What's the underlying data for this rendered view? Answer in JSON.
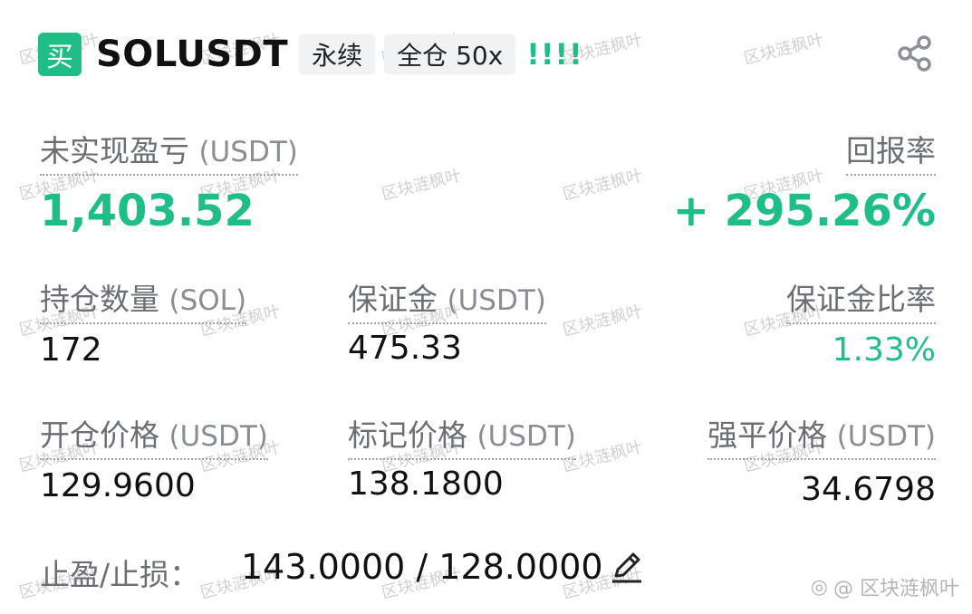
{
  "header": {
    "buy_badge": "买",
    "symbol": "SOLUSDT",
    "tag_perpetual": "永续",
    "tag_margin": "全仓 50x",
    "alert_marks": "!!!!"
  },
  "pnl": {
    "label": "未实现盈亏",
    "unit": "(USDT)",
    "value": "1,403.52"
  },
  "roe": {
    "label": "回报率",
    "value": "+ 295.26%"
  },
  "position_size": {
    "label": "持仓数量",
    "unit": "(SOL)",
    "value": "172"
  },
  "margin": {
    "label": "保证金",
    "unit": "(USDT)",
    "value": "475.33"
  },
  "margin_ratio": {
    "label": "保证金比率",
    "value": "1.33%"
  },
  "entry_price": {
    "label": "开仓价格",
    "unit": "(USDT)",
    "value": "129.9600"
  },
  "mark_price": {
    "label": "标记价格",
    "unit": "(USDT)",
    "value": "138.1800"
  },
  "liq_price": {
    "label": "强平价格",
    "unit": "(USDT)",
    "value": "34.6798"
  },
  "tpsl": {
    "label": "止盈/止损：",
    "value": "143.0000 / 128.0000"
  },
  "watermark": {
    "text": "区块涟枫叶",
    "footer": "@ 区块涟枫叶"
  },
  "colors": {
    "accent_green": "#1fbe86",
    "label_gray": "#6b6e75"
  },
  "icons": {
    "share": "share-icon",
    "edit": "pencil-icon"
  }
}
